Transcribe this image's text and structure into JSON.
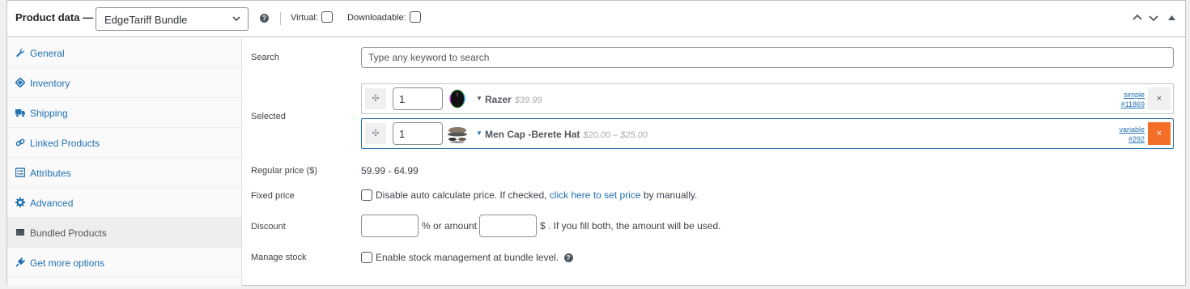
{
  "header": {
    "title": "Product data —",
    "product_type": "EdgeTariff Bundle",
    "help_glyph": "?",
    "virtual_label": "Virtual:",
    "downloadable_label": "Downloadable:",
    "controls": [
      "chevron-up-icon",
      "chevron-down-icon",
      "collapse-triangle-icon"
    ]
  },
  "sidebar": {
    "items": [
      {
        "label": "General",
        "icon": "wrench-icon"
      },
      {
        "label": "Inventory",
        "icon": "tag-icon"
      },
      {
        "label": "Shipping",
        "icon": "truck-icon"
      },
      {
        "label": "Linked Products",
        "icon": "link-icon"
      },
      {
        "label": "Attributes",
        "icon": "list-icon"
      },
      {
        "label": "Advanced",
        "icon": "gear-icon"
      },
      {
        "label": "Bundled Products",
        "icon": "box-icon",
        "active": true
      },
      {
        "label": "Get more options",
        "icon": "plugin-icon"
      }
    ]
  },
  "main": {
    "search": {
      "label": "Search",
      "placeholder": "Type any keyword to search"
    },
    "selected": {
      "label": "Selected",
      "items": [
        {
          "qty": "1",
          "name": "Razer",
          "price": "$39.99",
          "type": "simple",
          "id": "#11869"
        },
        {
          "qty": "1",
          "name": "Men Cap -Berete Hat",
          "price": "$20.00 – $25.00",
          "type": "variable",
          "id": "#292"
        }
      ]
    },
    "regular_price": {
      "label": "Regular price ($)",
      "value": "59.99 - 64.99"
    },
    "fixed_price": {
      "label": "Fixed price",
      "text_before": "Disable auto calculate price. If checked,",
      "link": "click here to set price",
      "text_after": "by manually."
    },
    "discount": {
      "label": "Discount",
      "mid_text": "% or amount",
      "tail_text": "$ . If you fill both, the amount will be used."
    },
    "manage_stock": {
      "label": "Manage stock",
      "text": "Enable stock management at bundle level."
    }
  },
  "colors": {
    "accent": "#2271b1",
    "remove_active": "#f56e28"
  }
}
